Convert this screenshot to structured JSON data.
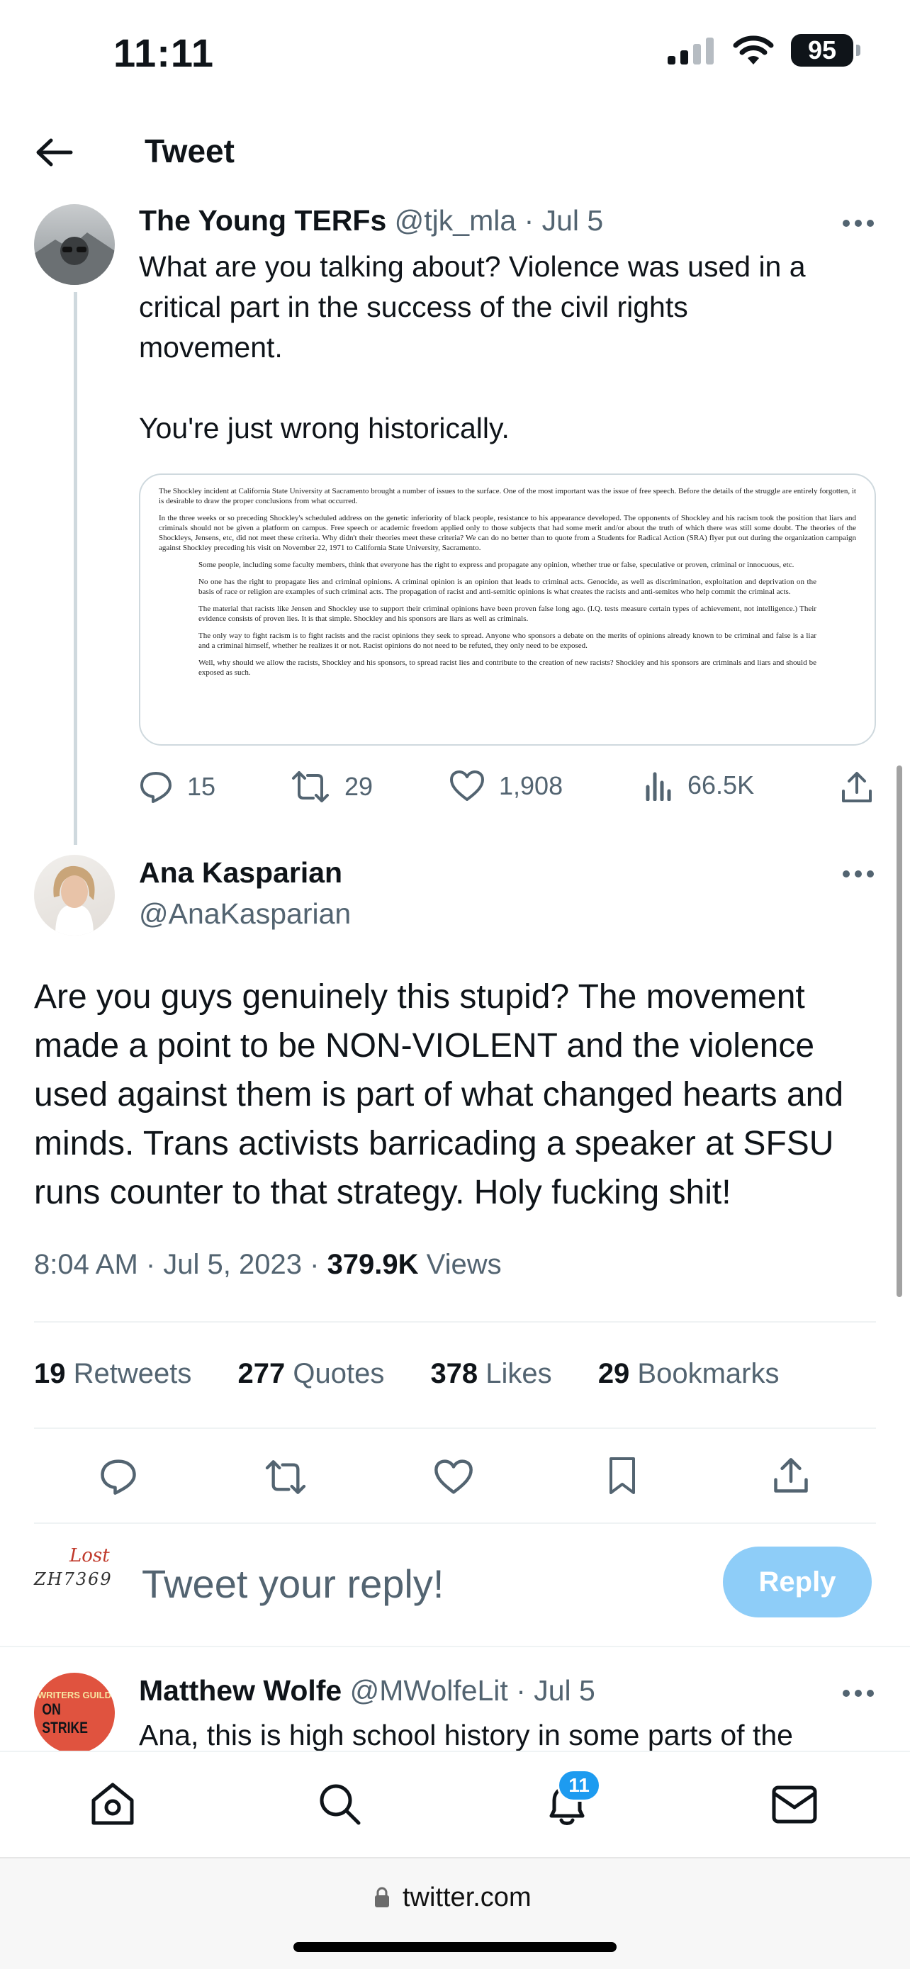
{
  "status_bar": {
    "time": "11:11",
    "battery": "95"
  },
  "header": {
    "title": "Tweet"
  },
  "parent_tweet": {
    "name": "The Young TERFs",
    "handle": "@tjk_mla",
    "date": "· Jul 5",
    "text_lines": [
      "What are you talking about? Violence was used in a",
      "critical part in the success of the civil rights",
      "movement.",
      "",
      "You're just wrong historically."
    ],
    "quote_paragraphs": [
      "The Shockley incident at California State University at Sacramento brought a number of issues to the surface. One of the most important was the issue of free speech. Before the details of the struggle are entirely forgotten, it is desirable to draw the proper conclusions from what occurred.",
      "In the three weeks or so preceding Shockley's scheduled address on the genetic inferiority of black people, resistance to his appearance developed. The opponents of Shockley and his racism took the position that liars and criminals should not be given a platform on campus. Free speech or academic freedom applied only to those subjects that had some merit and/or about the truth of which there was still some doubt. The theories of the Shockleys, Jensens, etc, did not meet these criteria. Why didn't their theories meet these criteria? We can do no better than to quote from a Students for Radical Action (SRA) flyer put out during the organization campaign against Shockley preceding his visit on November 22, 1971 to California State University, Sacramento.",
      "Some people, including some faculty members, think that everyone has the right to express and propagate any opinion, whether true or false, speculative or proven, criminal or innocuous, etc.",
      "No one has the right to propagate lies and criminal opinions. A criminal opinion is an opinion that leads to criminal acts. Genocide, as well as discrimination, exploitation and deprivation on the basis of race or religion are examples of such criminal acts. The propagation of racist and anti-semitic opinions is what creates the racists and anti-semites who help commit the criminal acts.",
      "The material that racists like Jensen and Shockley use to support their criminal opinions have been proven false long ago. (I.Q. tests measure certain types of achievement, not intelligence.) Their evidence consists of proven lies. It is that simple. Shockley and his sponsors are liars as well as criminals.",
      "The only way to fight racism is to fight racists and the racist opinions they seek to spread. Anyone who sponsors a debate on the merits of opinions already known to be criminal and false is a liar and a criminal himself, whether he realizes it or not. Racist opinions do not need to be refuted, they only need to be exposed.",
      "Well, why should we allow the racists, Shockley and his sponsors, to spread racist lies and contribute to the creation of new racists? Shockley and his sponsors are criminals and liars and should be exposed as such."
    ],
    "replies": "15",
    "retweets": "29",
    "likes": "1,908",
    "views": "66.5K"
  },
  "main_tweet": {
    "name": "Ana Kasparian",
    "handle": "@AnaKasparian",
    "text_lines": [
      "Are you guys genuinely this stupid? The movement",
      "made a point to be NON-VIOLENT and the violence",
      "used against them is part of what changed hearts and",
      "minds. Trans activists barricading a speaker at SFSU",
      "runs counter to that strategy. Holy fucking shit!"
    ],
    "timestamp": "8:04 AM · Jul 5, 2023 · ",
    "views_count": "379.9K",
    "views_label": " Views",
    "stats": [
      {
        "count": "19",
        "label": " Retweets"
      },
      {
        "count": "277",
        "label": " Quotes"
      },
      {
        "count": "378",
        "label": " Likes"
      },
      {
        "count": "29",
        "label": " Bookmarks"
      }
    ]
  },
  "reply_box": {
    "placeholder": "Tweet your reply!",
    "button": "Reply",
    "avatar_text_top": "Lost",
    "avatar_text_bottom": "ZH7369"
  },
  "next_tweet": {
    "name": "Matthew Wolfe",
    "handle": "@MWolfeLit",
    "date": "· Jul 5",
    "text": "Ana, this is high school history in some parts of the",
    "avatar_line1": "WRITERS GUILD",
    "avatar_line2": "ON STRIKE"
  },
  "bottom_nav": {
    "notifications_badge": "11"
  },
  "url_bar": {
    "domain": "twitter.com"
  },
  "colors": {
    "accent": "#1d9bf0",
    "reply_button": "#8ecdf8",
    "muted": "#536471",
    "strike_red": "#e0533f"
  }
}
